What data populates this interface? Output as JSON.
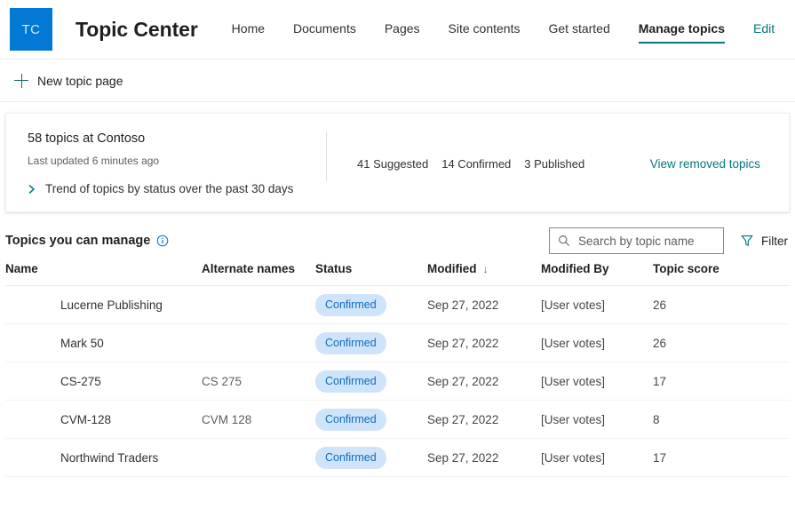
{
  "header": {
    "logo_text": "TC",
    "site_title": "Topic Center",
    "nav": [
      {
        "label": "Home",
        "state": "normal"
      },
      {
        "label": "Documents",
        "state": "normal"
      },
      {
        "label": "Pages",
        "state": "normal"
      },
      {
        "label": "Site contents",
        "state": "normal"
      },
      {
        "label": "Get started",
        "state": "normal"
      },
      {
        "label": "Manage topics",
        "state": "selected"
      },
      {
        "label": "Edit",
        "state": "link"
      }
    ]
  },
  "command_bar": {
    "new_topic_page_label": "New topic page",
    "plus_icon": "plus-icon"
  },
  "summary_card": {
    "heading": "58 topics at Contoso",
    "subtext": "Last updated 6 minutes ago",
    "trend_label": "Trend of topics by status over the past 30 days",
    "trend_icon": "chevron-right-icon",
    "stats": [
      "41 Suggested",
      "14 Confirmed",
      "3 Published"
    ],
    "view_removed_label": "View removed topics"
  },
  "list": {
    "title": "Topics you can manage",
    "info_icon": "info-icon",
    "search": {
      "placeholder": "Search by topic name",
      "value": "",
      "icon": "search-icon"
    },
    "filter": {
      "label": "Filter",
      "icon": "filter-icon"
    },
    "columns": [
      "Name",
      "Alternate names",
      "Status",
      "Modified",
      "Modified By",
      "Topic score"
    ],
    "sort": {
      "column": "Modified",
      "direction_glyph": "↓"
    },
    "rows": [
      {
        "name": "Lucerne Publishing",
        "alternate_names": "",
        "status": "Confirmed",
        "modified": "Sep 27, 2022",
        "modified_by": "[User votes]",
        "topic_score": "26"
      },
      {
        "name": "Mark 50",
        "alternate_names": "",
        "status": "Confirmed",
        "modified": "Sep 27, 2022",
        "modified_by": "[User votes]",
        "topic_score": "26"
      },
      {
        "name": "CS-275",
        "alternate_names": "CS 275",
        "status": "Confirmed",
        "modified": "Sep 27, 2022",
        "modified_by": "[User votes]",
        "topic_score": "17"
      },
      {
        "name": "CVM-128",
        "alternate_names": "CVM 128",
        "status": "Confirmed",
        "modified": "Sep 27, 2022",
        "modified_by": "[User votes]",
        "topic_score": "8"
      },
      {
        "name": "Northwind Traders",
        "alternate_names": "",
        "status": "Confirmed",
        "modified": "Sep 27, 2022",
        "modified_by": "[User votes]",
        "topic_score": "17"
      }
    ]
  },
  "colors": {
    "logo_bg": "#0078d4",
    "accent_teal": "#03787c",
    "badge_bg": "#cfe4fa",
    "badge_text": "#0f6cbd",
    "info_icon": "#0078d4"
  }
}
